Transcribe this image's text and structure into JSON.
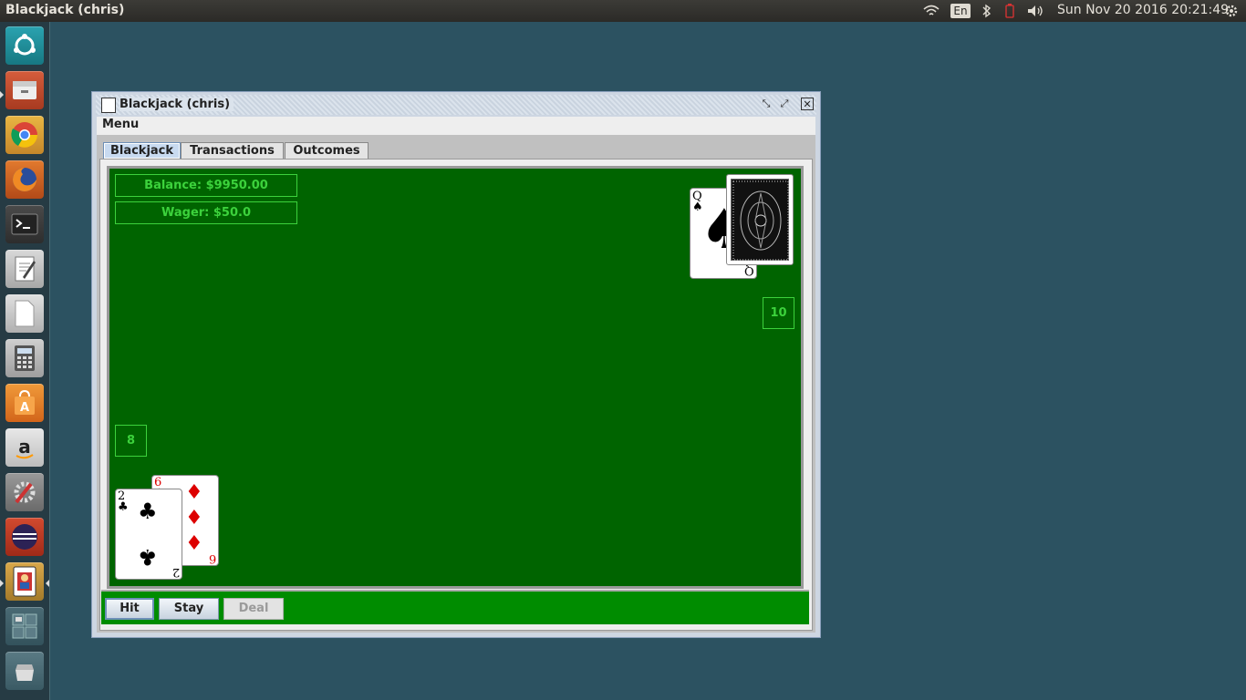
{
  "top_panel": {
    "app_title": "Blackjack (chris)",
    "keyboard_layout": "En",
    "clock": "Sun Nov 20 2016 20:21:49",
    "icons": [
      "wifi-icon",
      "keyboard-layout-indicator",
      "bluetooth-icon",
      "battery-icon",
      "volume-icon",
      "settings-gear-icon"
    ]
  },
  "launcher": {
    "items": [
      "ubuntu-dash",
      "files",
      "chrome",
      "firefox",
      "terminal",
      "text-editor",
      "libreoffice",
      "calculator",
      "software-center",
      "amazon",
      "system-settings",
      "eclipse",
      "blackjack-app",
      "workspace-switcher",
      "trash"
    ]
  },
  "window": {
    "title": "Blackjack (chris)",
    "menu": "Menu",
    "tabs": [
      "Blackjack",
      "Transactions",
      "Outcomes"
    ],
    "selected_tab": "Blackjack",
    "balance": "Balance: $9950.00",
    "wager": "Wager: $50.0",
    "dealer_total": "10",
    "player_total": "8",
    "dealer_cards": [
      {
        "rank": "Q",
        "suit": "♠",
        "color": "black"
      },
      {
        "rank": "",
        "suit": "",
        "face_down": true
      }
    ],
    "player_cards": [
      {
        "rank": "2",
        "suit": "♣",
        "color": "black"
      },
      {
        "rank": "6",
        "suit": "♦",
        "color": "red"
      }
    ],
    "buttons": {
      "hit": "Hit",
      "stay": "Stay",
      "deal": "Deal"
    },
    "deal_enabled": false
  },
  "colors": {
    "felt": "#006400",
    "text_green": "#3cd23c",
    "button_bar": "#008c00",
    "desktop": "#2c5261"
  }
}
